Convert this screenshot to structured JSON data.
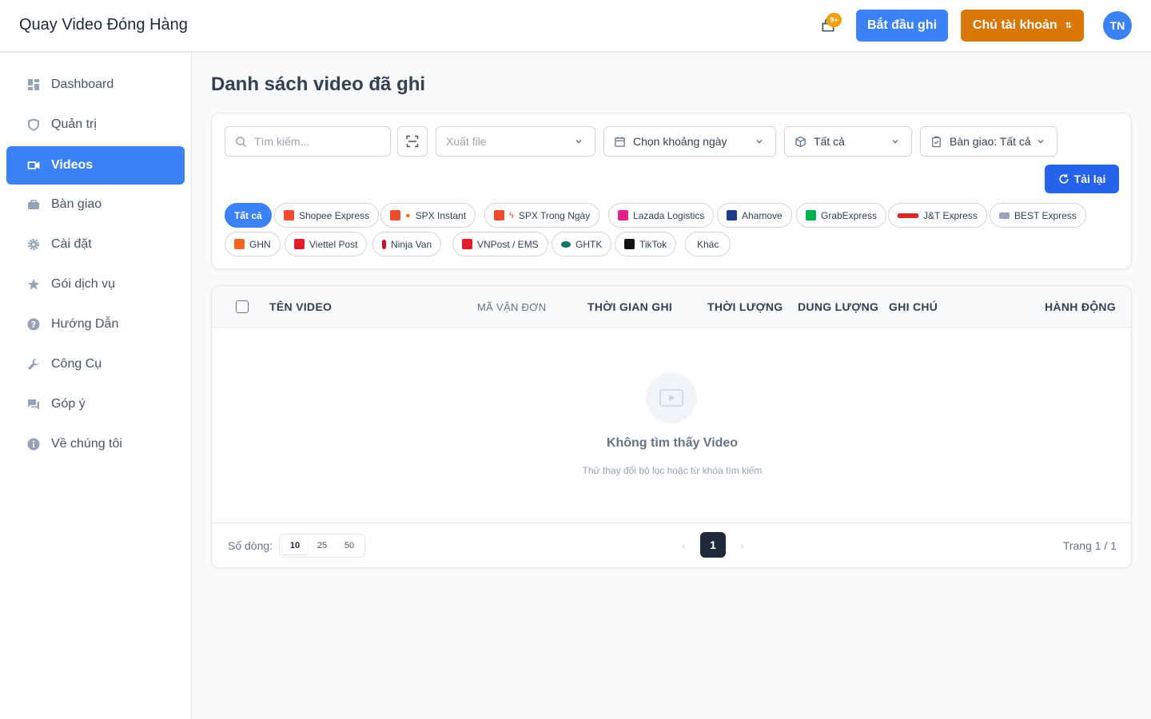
{
  "app": {
    "title": "Quay Video Đóng Hàng"
  },
  "header": {
    "notification_badge": "9+",
    "record_button": "Bắt đầu ghi",
    "owner_button": "Chủ tài khoản",
    "owner_swap_icon": "⇅",
    "avatar_initials": "TN"
  },
  "sidebar": {
    "items": [
      {
        "label": "Dashboard",
        "icon": "dashboard-icon",
        "active": false
      },
      {
        "label": "Quản trị",
        "icon": "shield-icon",
        "active": false
      },
      {
        "label": "Videos",
        "icon": "video-icon",
        "active": true
      },
      {
        "label": "Bàn giao",
        "icon": "briefcase-icon",
        "active": false
      },
      {
        "label": "Cài đặt",
        "icon": "gear-icon",
        "active": false
      },
      {
        "label": "Gói dịch vụ",
        "icon": "star-icon",
        "active": false
      },
      {
        "label": "Hướng Dẫn",
        "icon": "help-icon",
        "active": false
      },
      {
        "label": "Công Cụ",
        "icon": "wrench-icon",
        "active": false
      },
      {
        "label": "Góp ý",
        "icon": "feedback-icon",
        "active": false
      },
      {
        "label": "Về chúng tôi",
        "icon": "info-icon",
        "active": false
      }
    ]
  },
  "main": {
    "title": "Danh sách video đã ghi",
    "filters": {
      "search_placeholder": "Tìm kiếm...",
      "export_placeholder": "Xuất file",
      "date_range": "Chọn khoảng ngày",
      "status": "Tất cả",
      "handover": "Bàn giao: Tất cả",
      "reload_button": "Tải lại"
    },
    "carriers": [
      {
        "label": "Tất cả",
        "active": true
      },
      {
        "label": "Shopee Express",
        "color": "#ee4d2d"
      },
      {
        "label": "SPX Instant",
        "color": "#ee4d2d"
      },
      {
        "label": "SPX Trong Ngày",
        "color": "#ee4d2d"
      },
      {
        "label": "Lazada Logistics",
        "color": "#e4208c"
      },
      {
        "label": "Ahamove",
        "color": "#1e3a8a"
      },
      {
        "label": "GrabExpress",
        "color": "#00b14f"
      },
      {
        "label": "J&T Express",
        "color": "#dc2626"
      },
      {
        "label": "BEST Express",
        "color": "#64748b"
      },
      {
        "label": "GHN",
        "color": "#f26522"
      },
      {
        "label": "Viettel Post",
        "color": "#e11d2a"
      },
      {
        "label": "Ninja Van",
        "color": "#c8102e"
      },
      {
        "label": "VNPost / EMS",
        "color": "#e11d2a"
      },
      {
        "label": "GHTK",
        "color": "#0f766e"
      },
      {
        "label": "TikTok",
        "color": "#111111"
      },
      {
        "label": "Khác"
      }
    ],
    "table": {
      "columns": [
        "TÊN VIDEO",
        "MÃ VẬN ĐƠN",
        "THỜI GIAN GHI",
        "THỜI LƯỢNG",
        "DUNG LƯỢNG",
        "GHI CHÚ",
        "HÀNH ĐỘNG"
      ],
      "rows": [],
      "empty_title": "Không tìm thấy Video",
      "empty_subtitle": "Thử thay đổi bộ lọc hoặc từ khóa tìm kiếm"
    },
    "pagination": {
      "rows_label": "Số dòng:",
      "rows_options": [
        "10",
        "25",
        "50"
      ],
      "rows_selected": "10",
      "prev": "‹",
      "current_page": "1",
      "next": "›",
      "page_info": "Trang 1 / 1"
    }
  }
}
